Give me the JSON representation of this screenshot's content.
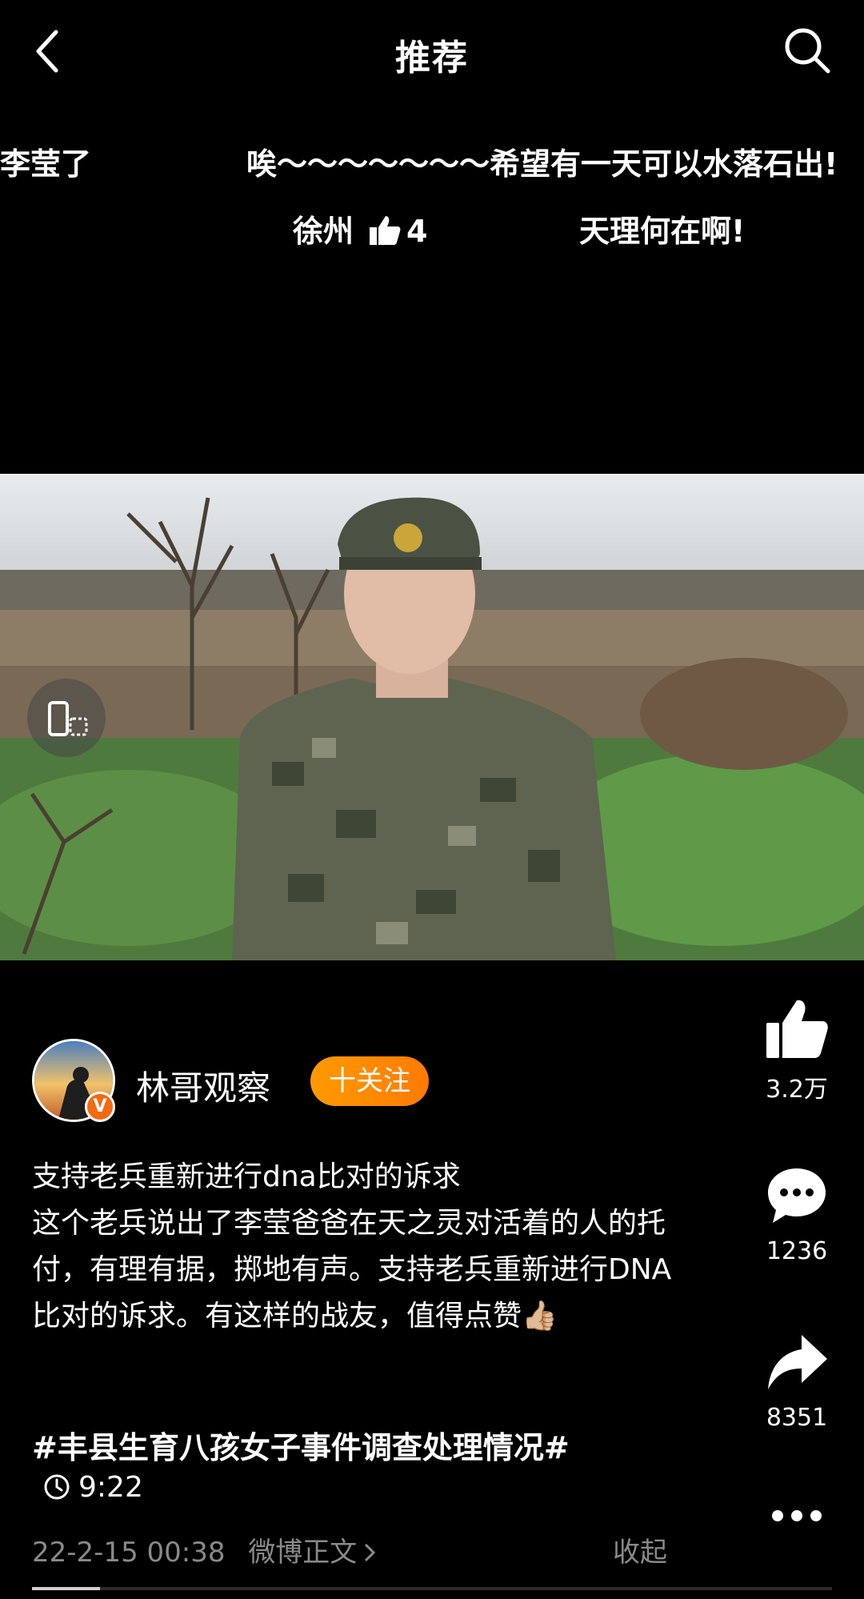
{
  "header": {
    "title": "推荐",
    "back_icon": "chevron-left-icon",
    "search_icon": "search-icon"
  },
  "danmaku": [
    {
      "text": "李莹了"
    },
    {
      "text": "唉～～～～～～～希望有一天可以水落石出!"
    },
    {
      "text": "徐州",
      "likes": "4"
    },
    {
      "text": "天理何在啊!"
    }
  ],
  "video": {
    "rotate_icon": "rotate-screen-icon"
  },
  "author": {
    "name": "林哥观察",
    "follow_label": "十关注",
    "verified_mark": "V"
  },
  "post": {
    "line1": "支持老兵重新进行dna比对的诉求",
    "body": "这个老兵说出了李莹爸爸在天之灵对活着的人的托付，有理有据，掷地有声。支持老兵重新进行DNA比对的诉求。有这样的战友，值得点赞👍🏼",
    "hashtag": "#丰县生育八孩女子事件调查处理情况#",
    "duration": "9:22",
    "timestamp": "22-2-15 00:38",
    "source_link": "微博正文",
    "collapse_label": "收起"
  },
  "actions": {
    "likes": "3.2万",
    "comments": "1236",
    "shares": "8351"
  },
  "progress": {
    "fraction": 0.085
  },
  "colors": {
    "follow": "#ff8a00",
    "badge": "#f26a12",
    "meta": "#8a8a8a"
  }
}
